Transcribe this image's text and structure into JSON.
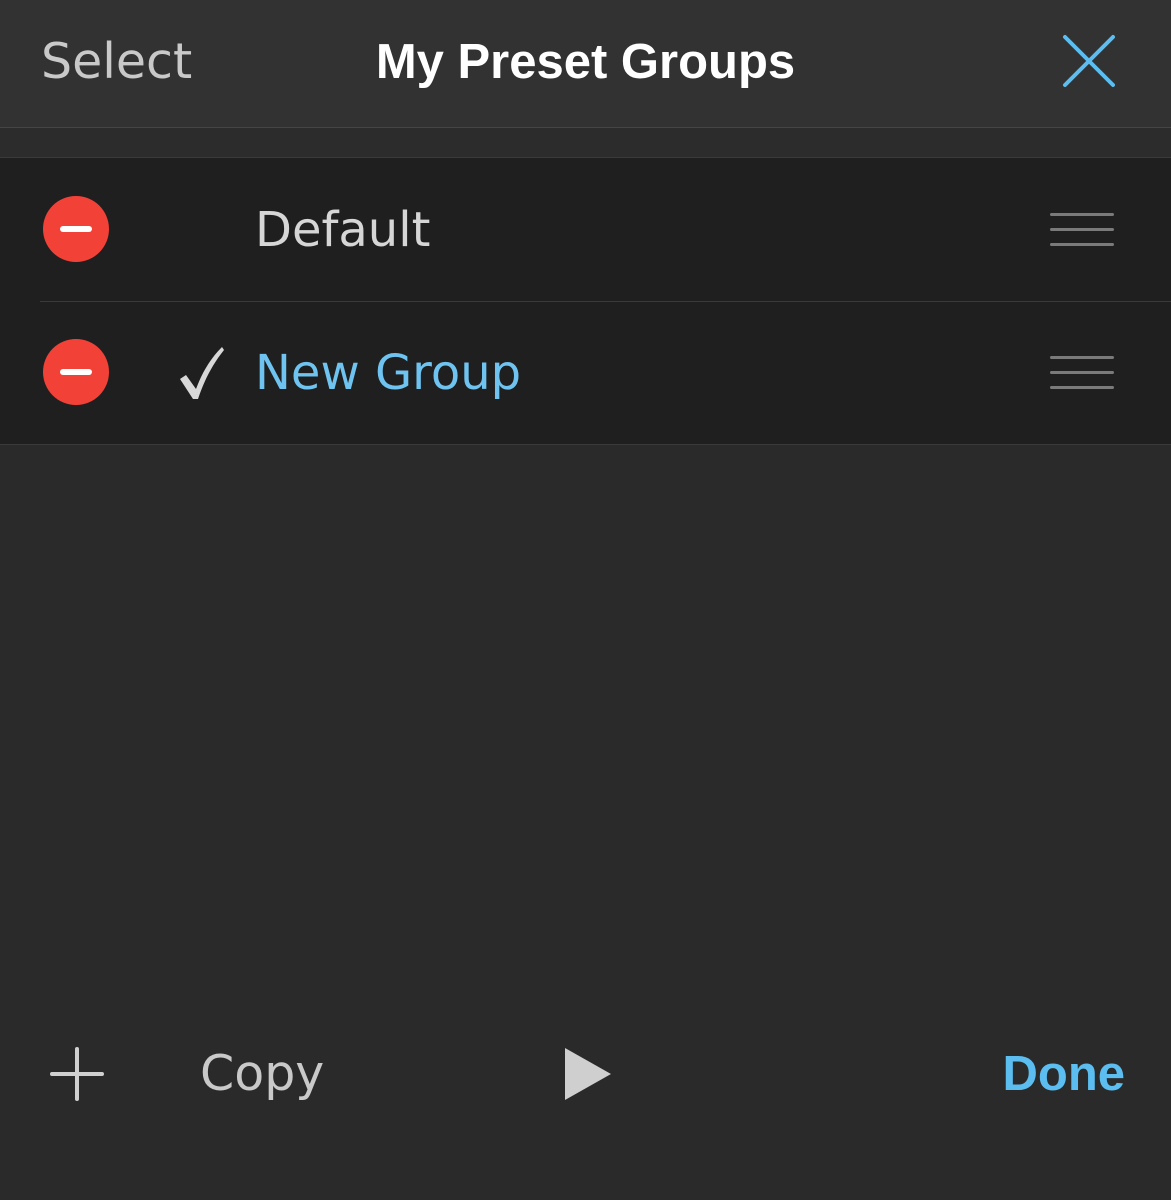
{
  "header": {
    "select_label": "Select",
    "title": "My Preset Groups",
    "close_icon": "close-icon"
  },
  "groups": [
    {
      "label": "Default",
      "selected": false
    },
    {
      "label": "New Group",
      "selected": true
    }
  ],
  "toolbar": {
    "add_icon": "plus-icon",
    "copy_label": "Copy",
    "play_icon": "play-icon",
    "done_label": "Done"
  },
  "colors": {
    "accent": "#5bbdf0",
    "delete": "#f24238",
    "background": "#2a2a2a",
    "list_background": "#1f1f1f",
    "header_background": "#323232"
  }
}
